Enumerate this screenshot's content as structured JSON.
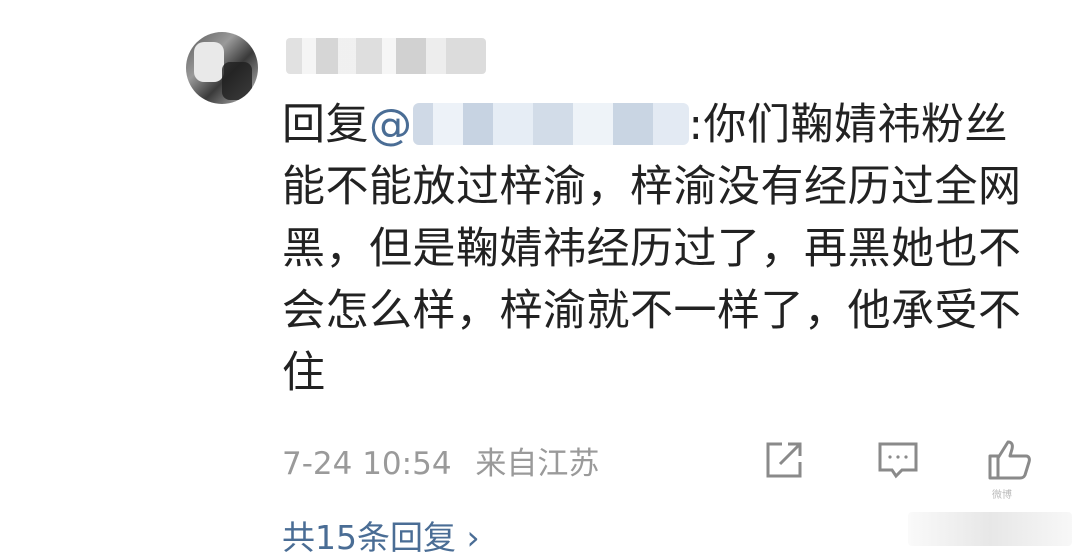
{
  "comment": {
    "reply_prefix": "回复",
    "mention_symbol": "@",
    "text": ":你们鞠婧祎粉丝能不能放过梓渝，梓渝没有经历过全网黑，但是鞠婧祎经历过了，再黑她也不会怎么样，梓渝就不一样了，他承受不住"
  },
  "meta": {
    "timestamp": "7-24 10:54",
    "location": "来自江苏"
  },
  "actions": {
    "forward_icon": "share-icon",
    "comment_icon": "comment-icon",
    "like_icon": "thumbs-up-icon"
  },
  "replies": {
    "label": "共15条回复",
    "chevron": "›"
  },
  "watermark": {
    "small_text": "微博"
  }
}
